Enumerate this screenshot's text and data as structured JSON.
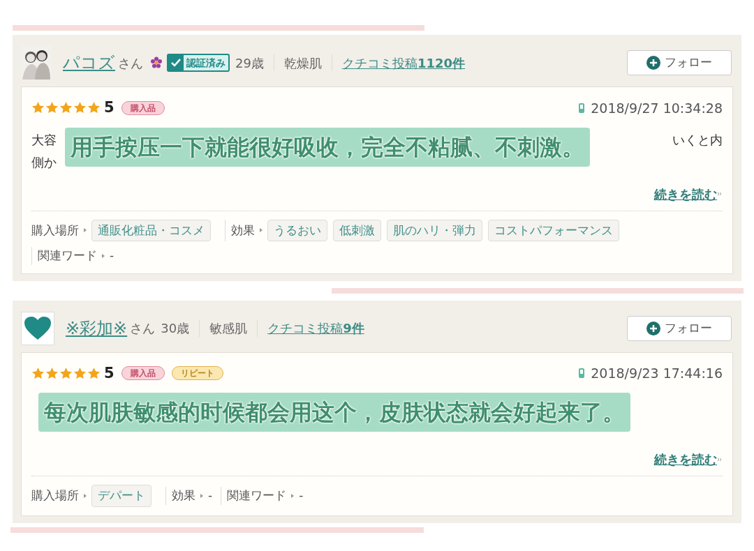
{
  "reviews": [
    {
      "user": {
        "name": "パコズ",
        "honorific": "さん",
        "flower": true,
        "verified": "認証済み",
        "age": "29歳",
        "skin": "乾燥肌",
        "posts_prefix": "クチコミ投稿",
        "posts_count": "1120件"
      },
      "follow": "フォロー",
      "stars": 5,
      "score": "5",
      "badges": [
        {
          "text": "購入品",
          "kind": "purchase"
        }
      ],
      "date": "2018/9/27 10:34:28",
      "body_lines": [
        {
          "left": "大容",
          "right": "いくと内"
        },
        {
          "left": "側か"
        }
      ],
      "subtitle": "用手按压一下就能很好吸收，完全不粘腻、不刺激。",
      "read_more": "続きを読む",
      "meta": [
        {
          "label": "購入場所",
          "tags": [
            "通販化粧品・コスメ"
          ]
        },
        {
          "label": "効果",
          "tags": [
            "うるおい",
            "低刺激",
            "肌のハリ・弾力",
            "コストパフォーマンス"
          ]
        },
        {
          "label": "関連ワード",
          "value": "-"
        }
      ]
    },
    {
      "user": {
        "name": "※彩加※",
        "honorific": "さん",
        "flower": false,
        "age": "30歳",
        "skin": "敏感肌",
        "posts_prefix": "クチコミ投稿",
        "posts_count": "9件",
        "avatar": {
          "kind": "heart"
        }
      },
      "follow": "フォロー",
      "stars": 5,
      "score": "5",
      "badges": [
        {
          "text": "購入品",
          "kind": "purchase"
        },
        {
          "text": "リピート",
          "kind": "repeat"
        }
      ],
      "date": "2018/9/23 17:44:16",
      "subtitle": "每次肌肤敏感的时候都会用这个，皮肤状态就会好起来了。",
      "read_more": "続きを読む",
      "meta": [
        {
          "label": "購入場所",
          "tags": [
            "デパート"
          ]
        },
        {
          "label": "効果",
          "value": "-"
        },
        {
          "label": "関連ワード",
          "value": "-"
        }
      ]
    }
  ]
}
